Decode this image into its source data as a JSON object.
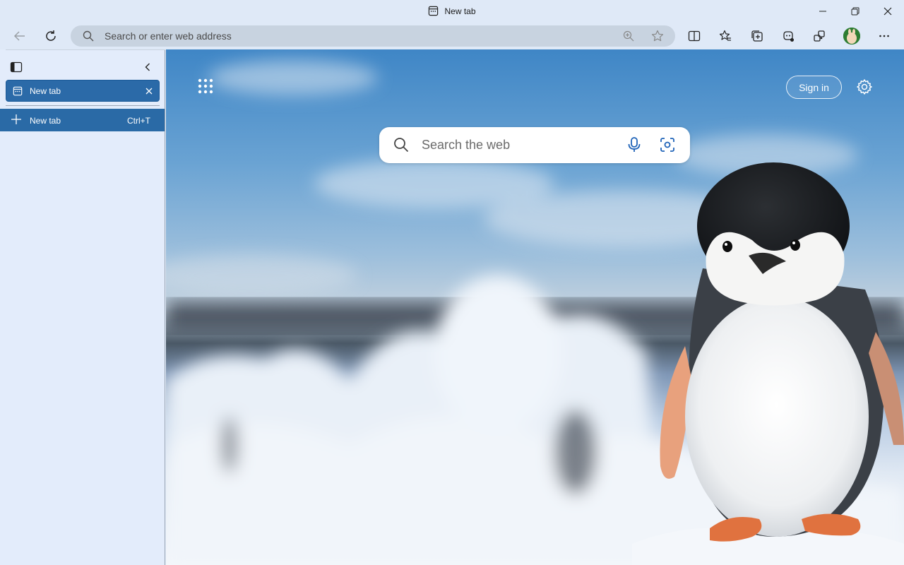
{
  "window": {
    "title": "New tab"
  },
  "toolbar": {
    "address_placeholder": "Search or enter web address"
  },
  "sidebar": {
    "active_tab_label": "New tab",
    "new_tab_label": "New tab",
    "new_tab_shortcut": "Ctrl+T"
  },
  "newtab_page": {
    "search_placeholder": "Search the web",
    "signin_label": "Sign in"
  },
  "colors": {
    "accent": "#2b6aa8",
    "chrome_bg": "#dfe9f7",
    "sidebar_bg": "#e3ecfb"
  },
  "icons": [
    "tab-icon",
    "minimize-icon",
    "restore-icon",
    "close-icon",
    "back-arrow-icon",
    "refresh-icon",
    "search-icon",
    "zoom-icon",
    "favorite-star-icon",
    "split-screen-icon",
    "favorites-icon",
    "collections-icon",
    "copilot-icon",
    "extensions-icon",
    "more-icon",
    "vertical-tabs-icon",
    "collapse-chevron-icon",
    "plus-icon",
    "apps-grid-icon",
    "settings-gear-icon",
    "microphone-icon",
    "visual-search-icon"
  ]
}
